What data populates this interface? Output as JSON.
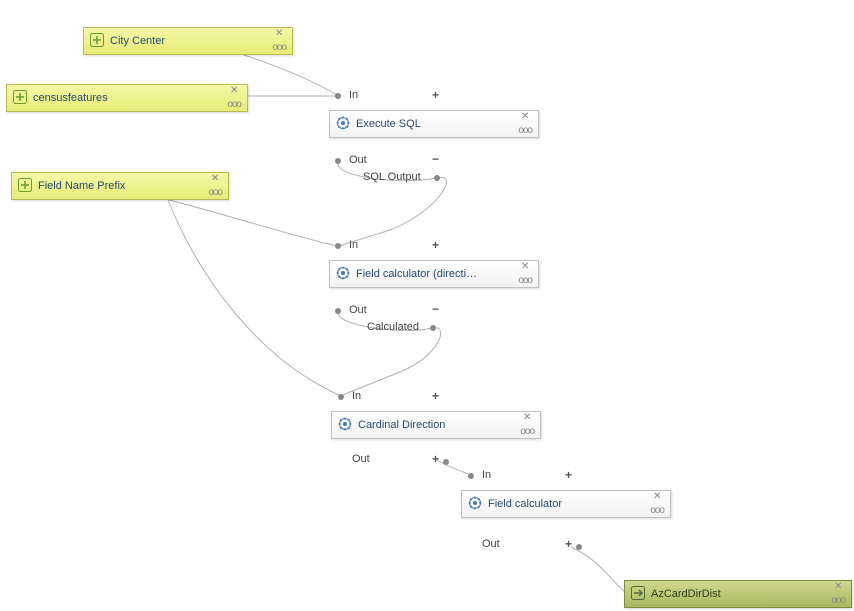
{
  "inputs": {
    "cityCenter": {
      "label": "City Center"
    },
    "censusFeatures": {
      "label": "censusfeatures"
    },
    "fieldNamePrefix": {
      "label": "Field Name Prefix"
    }
  },
  "algorithms": {
    "executeSql": {
      "label": "Execute SQL",
      "inLabel": "In",
      "outLabel": "Out",
      "outputName": "SQL Output"
    },
    "fieldCalcDirection": {
      "label": "Field calculator (directi…",
      "inLabel": "In",
      "outLabel": "Out",
      "outputName": "Calculated"
    },
    "cardinalDirection": {
      "label": "Cardinal Direction",
      "inLabel": "In",
      "outLabel": "Out"
    },
    "fieldCalculator": {
      "label": "Field calculator",
      "inLabel": "In",
      "outLabel": "Out"
    }
  },
  "outputs": {
    "azCardDirDist": {
      "label": "AzCardDirDist"
    }
  },
  "symbols": {
    "plus": "+",
    "minus": "−",
    "close": "✕",
    "grip": "ooo"
  }
}
